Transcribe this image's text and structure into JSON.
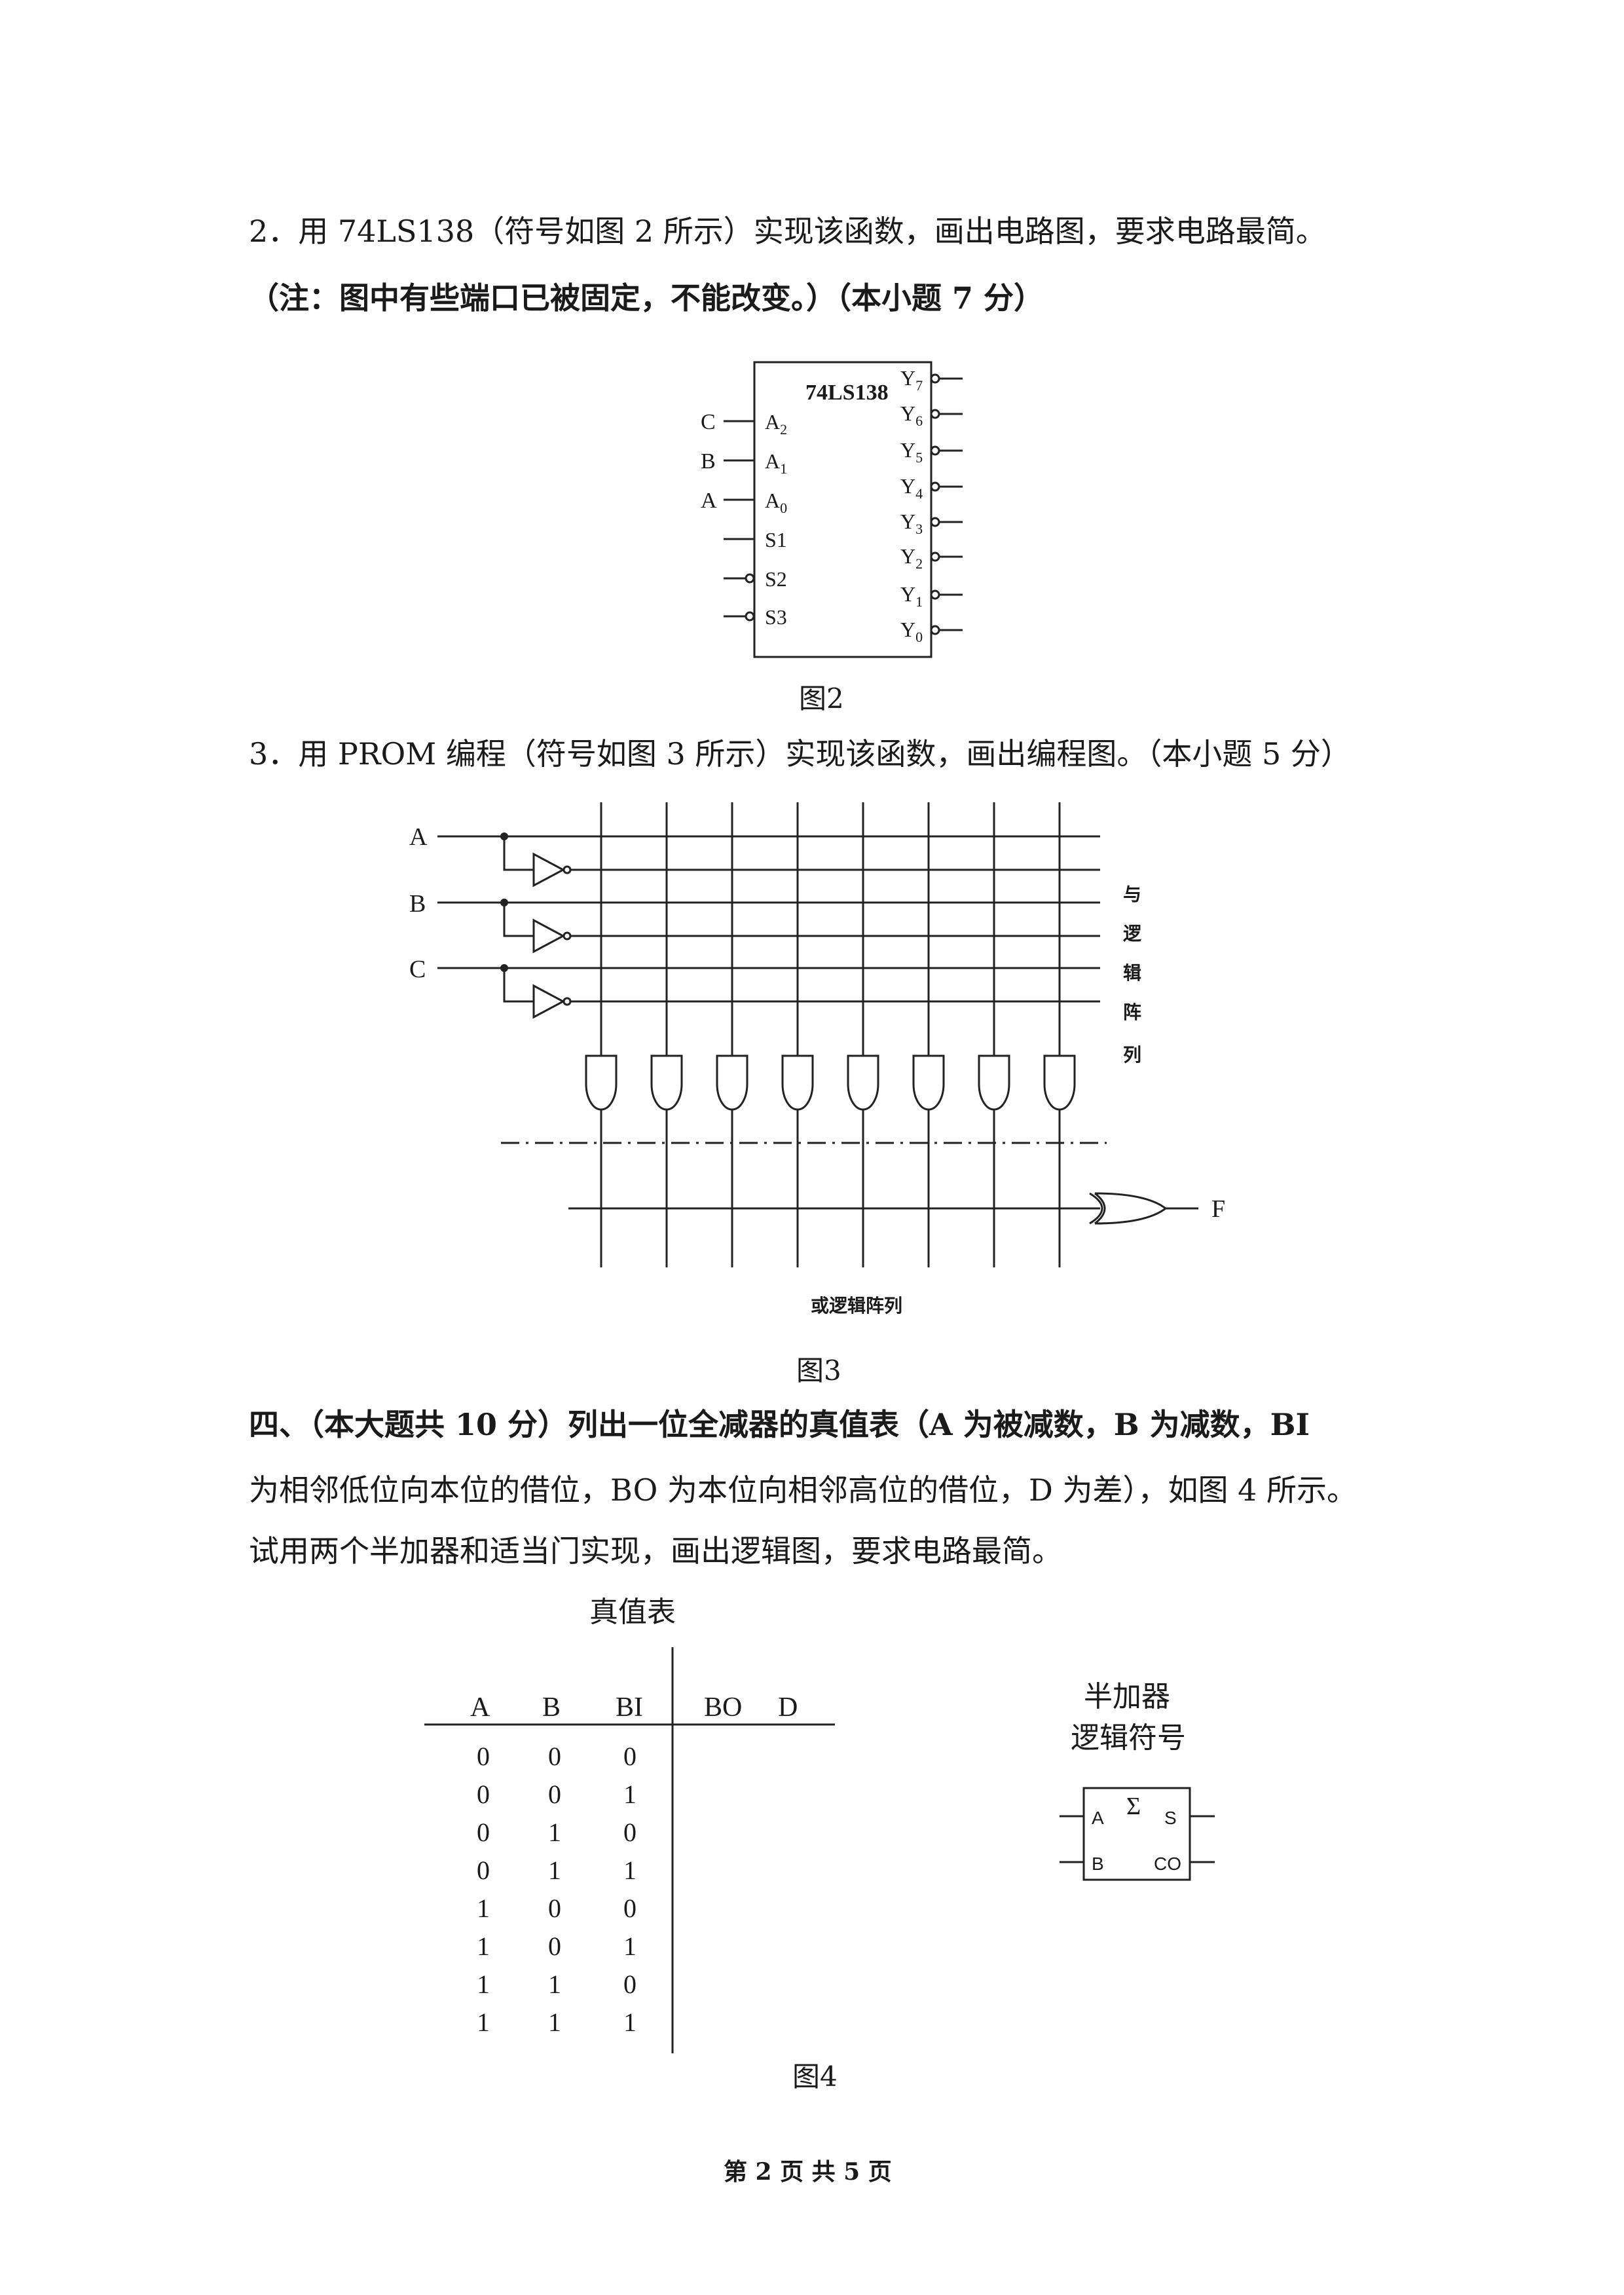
{
  "q2": {
    "line1": "2．用 74LS138（符号如图 2 所示）实现该函数，画出电路图，要求电路最简。",
    "line2": "（注：图中有些端口已被固定，不能改变。）（本小题 7 分）",
    "chip_name": "74LS138",
    "inputs": [
      {
        "signal": "C",
        "pin": "A",
        "sub": "2"
      },
      {
        "signal": "B",
        "pin": "A",
        "sub": "1"
      },
      {
        "signal": "A",
        "pin": "A",
        "sub": "0"
      }
    ],
    "enables": [
      "S1",
      "S2",
      "S3"
    ],
    "outputs": [
      {
        "pin": "Y",
        "sub": "7"
      },
      {
        "pin": "Y",
        "sub": "6"
      },
      {
        "pin": "Y",
        "sub": "5"
      },
      {
        "pin": "Y",
        "sub": "4"
      },
      {
        "pin": "Y",
        "sub": "3"
      },
      {
        "pin": "Y",
        "sub": "2"
      },
      {
        "pin": "Y",
        "sub": "1"
      },
      {
        "pin": "Y",
        "sub": "0"
      }
    ],
    "caption": "图2"
  },
  "q3": {
    "line1": "3．用 PROM 编程（符号如图 3 所示）实现该函数，画出编程图。（本小题 5 分）",
    "inputs": [
      "A",
      "B",
      "C"
    ],
    "and_array_label": [
      "与",
      "逻",
      "辑",
      "阵",
      "列"
    ],
    "or_array_label": "或逻辑阵列",
    "output": "F",
    "caption": "图3"
  },
  "q4": {
    "line1": "四、（本大题共 10 分）列出一位全减器的真值表（A 为被减数，B 为减数，BI",
    "line2": "为相邻低位向本位的借位，BO 为本位向相邻高位的借位，D 为差），如图 4 所示。",
    "line3": "试用两个半加器和适当门实现，画出逻辑图，要求电路最简。",
    "table_title": "真值表",
    "headers_in": [
      "A",
      "B",
      "BI"
    ],
    "headers_out": [
      "BO",
      "D"
    ],
    "rows": [
      [
        "0",
        "0",
        "0"
      ],
      [
        "0",
        "0",
        "1"
      ],
      [
        "0",
        "1",
        "0"
      ],
      [
        "0",
        "1",
        "1"
      ],
      [
        "1",
        "0",
        "0"
      ],
      [
        "1",
        "0",
        "1"
      ],
      [
        "1",
        "1",
        "0"
      ],
      [
        "1",
        "1",
        "1"
      ]
    ],
    "half_adder_title": [
      "半加器",
      "逻辑符号"
    ],
    "half_adder_pins": {
      "a": "A",
      "b": "B",
      "sigma": "Σ",
      "s": "S",
      "co": "CO"
    },
    "caption": "图4"
  },
  "footer": "第 2 页 共 5 页"
}
